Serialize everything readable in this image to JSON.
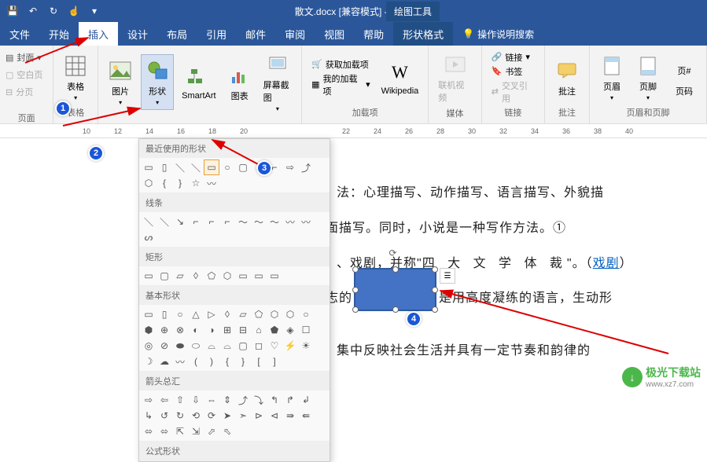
{
  "title": "散文.docx [兼容模式] - Word",
  "title_tools": "绘图工具",
  "menu": [
    "文件",
    "开始",
    "插入",
    "设计",
    "布局",
    "引用",
    "邮件",
    "审阅",
    "视图",
    "帮助",
    "形状格式"
  ],
  "tell_me": "操作说明搜索",
  "ribbon_left": {
    "cover": "封面",
    "blank": "空白页",
    "break": "分页"
  },
  "groups": {
    "pages": "页面",
    "table": "表格",
    "table_btn": "表格",
    "illus": {
      "pic": "图片",
      "shapes": "形状",
      "smartart": "SmartArt",
      "chart": "图表",
      "screenshot": "屏幕截图"
    },
    "addins": {
      "label": "加载项",
      "get": "获取加载项",
      "my": "我的加载项",
      "wiki": "Wikipedia"
    },
    "media": {
      "label": "媒体",
      "video": "联机视频"
    },
    "links": {
      "label": "链接",
      "link": "链接",
      "bookmark": "书签",
      "xref": "交叉引用"
    },
    "comments": {
      "label": "批注",
      "btn": "批注"
    },
    "hf": {
      "label": "页眉和页脚",
      "header": "页眉",
      "footer": "页脚",
      "pagenum": "页码"
    }
  },
  "shapes_panel": {
    "recent": "最近使用的形状",
    "lines": "线条",
    "rect": "矩形",
    "basic": "基本形状",
    "arrows": "箭头总汇",
    "formula": "公式形状"
  },
  "ruler": [
    "10",
    "12",
    "14",
    "16",
    "18",
    "20",
    "22",
    "24",
    "26",
    "28",
    "30",
    "32",
    "34",
    "36",
    "38",
    "40"
  ],
  "doc_lines": {
    "l1": "法：心理描写、动作描写、语言描写、外貌描",
    "l2": "面描写。同时，小说是一种写作方法。①",
    "l3a": "、戏剧，并称\"",
    "l3b": "四 大 文 学 体 裁",
    "l3c": "\"。（",
    "l3link": "戏剧",
    "l3d": "）",
    "l4a": "志的",
    "l4b": "是用",
    "l4c": "高度凝练的语言，生动形",
    "l5": "集中反映社会生活并具有一定节奏和韵律的"
  },
  "badges": [
    "1",
    "2",
    "3",
    "4"
  ],
  "watermark": {
    "name": "极光下载站",
    "url": "www.xz7.com"
  }
}
